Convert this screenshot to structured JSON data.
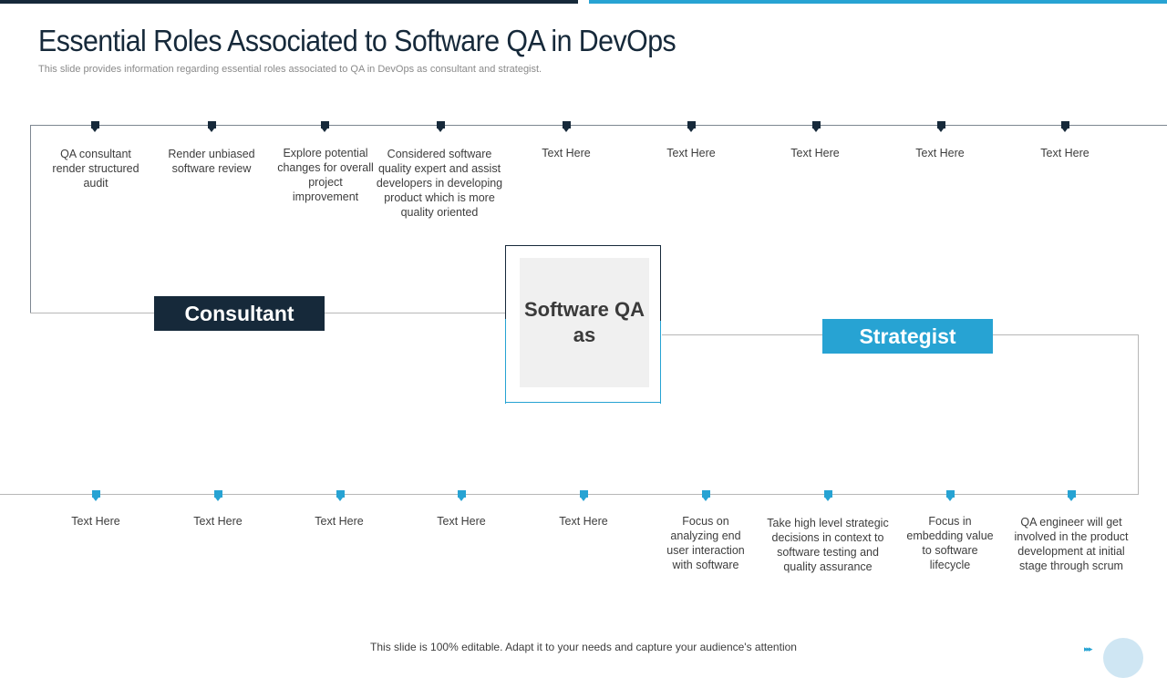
{
  "header": {
    "title": "Essential Roles Associated to Software QA in DevOps",
    "subtitle": "This slide provides information regarding essential roles associated to QA in DevOps as consultant and strategist."
  },
  "center": {
    "label": "Software QA as"
  },
  "consultant": {
    "label": "Consultant",
    "items": [
      "QA consultant render structured audit",
      "Render unbiased software review",
      "Explore potential changes for overall project improvement",
      "Considered software quality expert and assist developers in developing product which is more quality oriented",
      "Text Here",
      "Text Here",
      "Text Here",
      "Text Here",
      "Text Here"
    ]
  },
  "strategist": {
    "label": "Strategist",
    "items": [
      "Text Here",
      "Text Here",
      "Text Here",
      "Text Here",
      "Text Here",
      "Focus on analyzing end user interaction with software",
      "Take high level strategic decisions in context to software testing and quality assurance",
      "Focus in embedding value to software lifecycle",
      "QA engineer will get involved in the product development at initial stage through scrum"
    ]
  },
  "footer": {
    "text": "This slide is 100% editable. Adapt it to your needs and capture your audience's attention",
    "nav_icon": "triple-chevron-right-icon"
  },
  "colors": {
    "dark": "#16293a",
    "accent": "#27a3d3"
  }
}
